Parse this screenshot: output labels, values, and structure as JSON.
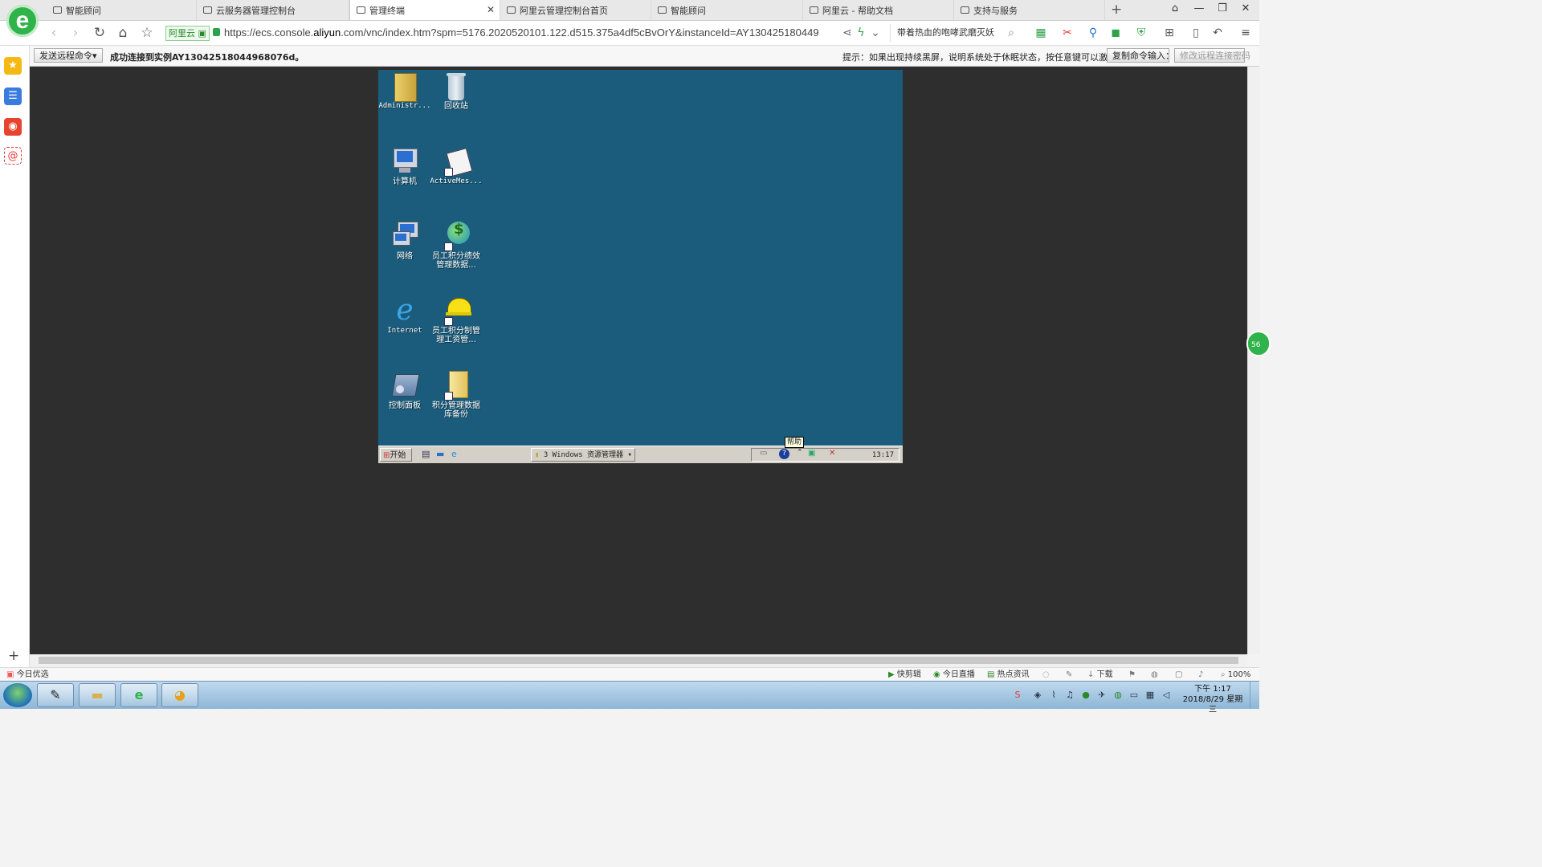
{
  "browser": {
    "tabs": [
      {
        "label": "智能顾问"
      },
      {
        "label": "云服务器管理控制台"
      },
      {
        "label": "管理终端",
        "active": true
      },
      {
        "label": "阿里云管理控制台首页"
      },
      {
        "label": "智能顾问"
      },
      {
        "label": "阿里云 - 帮助文档"
      },
      {
        "label": "支持与服务"
      }
    ],
    "new_tab": "+",
    "secure_badge": "阿里云",
    "url_prefix": "https://",
    "url_host_pre": "ecs.console.",
    "url_host": "aliyun",
    "url_host_post": ".com",
    "url_path": "/vnc/index.htm?spm=5176.2020520101.122.d515.375a4df5cBvOrY&instanceId=AY130425180449",
    "search_text": "带着热血的咆哮武磨灭妖"
  },
  "vnc": {
    "send_command_label": "发送远程命令▾",
    "connected_text": "成功连接到实例AY13042518044968076d。",
    "hint_text": "提示：如果出现持续黑屏，说明系统处于休眠状态，按任意键可以激活。",
    "copy_command_label": "复制命令输入：",
    "change_password_label": "修改远程连接密码"
  },
  "remote_desktop": {
    "icons": [
      {
        "label": "Administr..."
      },
      {
        "label": "回收站"
      },
      {
        "label": "计算机"
      },
      {
        "label": "ActiveMes..."
      },
      {
        "label": "网络"
      },
      {
        "label": "员工积分绩效管理数据..."
      },
      {
        "label": "Internet"
      },
      {
        "label": "员工积分制管理工资管..."
      },
      {
        "label": "控制面板"
      },
      {
        "label": "积分管理数据库备份"
      }
    ],
    "start_label": "开始",
    "explorer_label": "3 Windows 资源管理器",
    "clock": "13:17",
    "tooltip": "帮助"
  },
  "side_bubble": "56",
  "statusbar": {
    "left_label": "今日优选",
    "items": [
      "快剪辑",
      "今日直播",
      "热点资讯",
      "下载"
    ],
    "zoom": "100%"
  },
  "windows_taskbar": {
    "time": "下午 1:17",
    "date": "2018/8/29 星期三"
  }
}
